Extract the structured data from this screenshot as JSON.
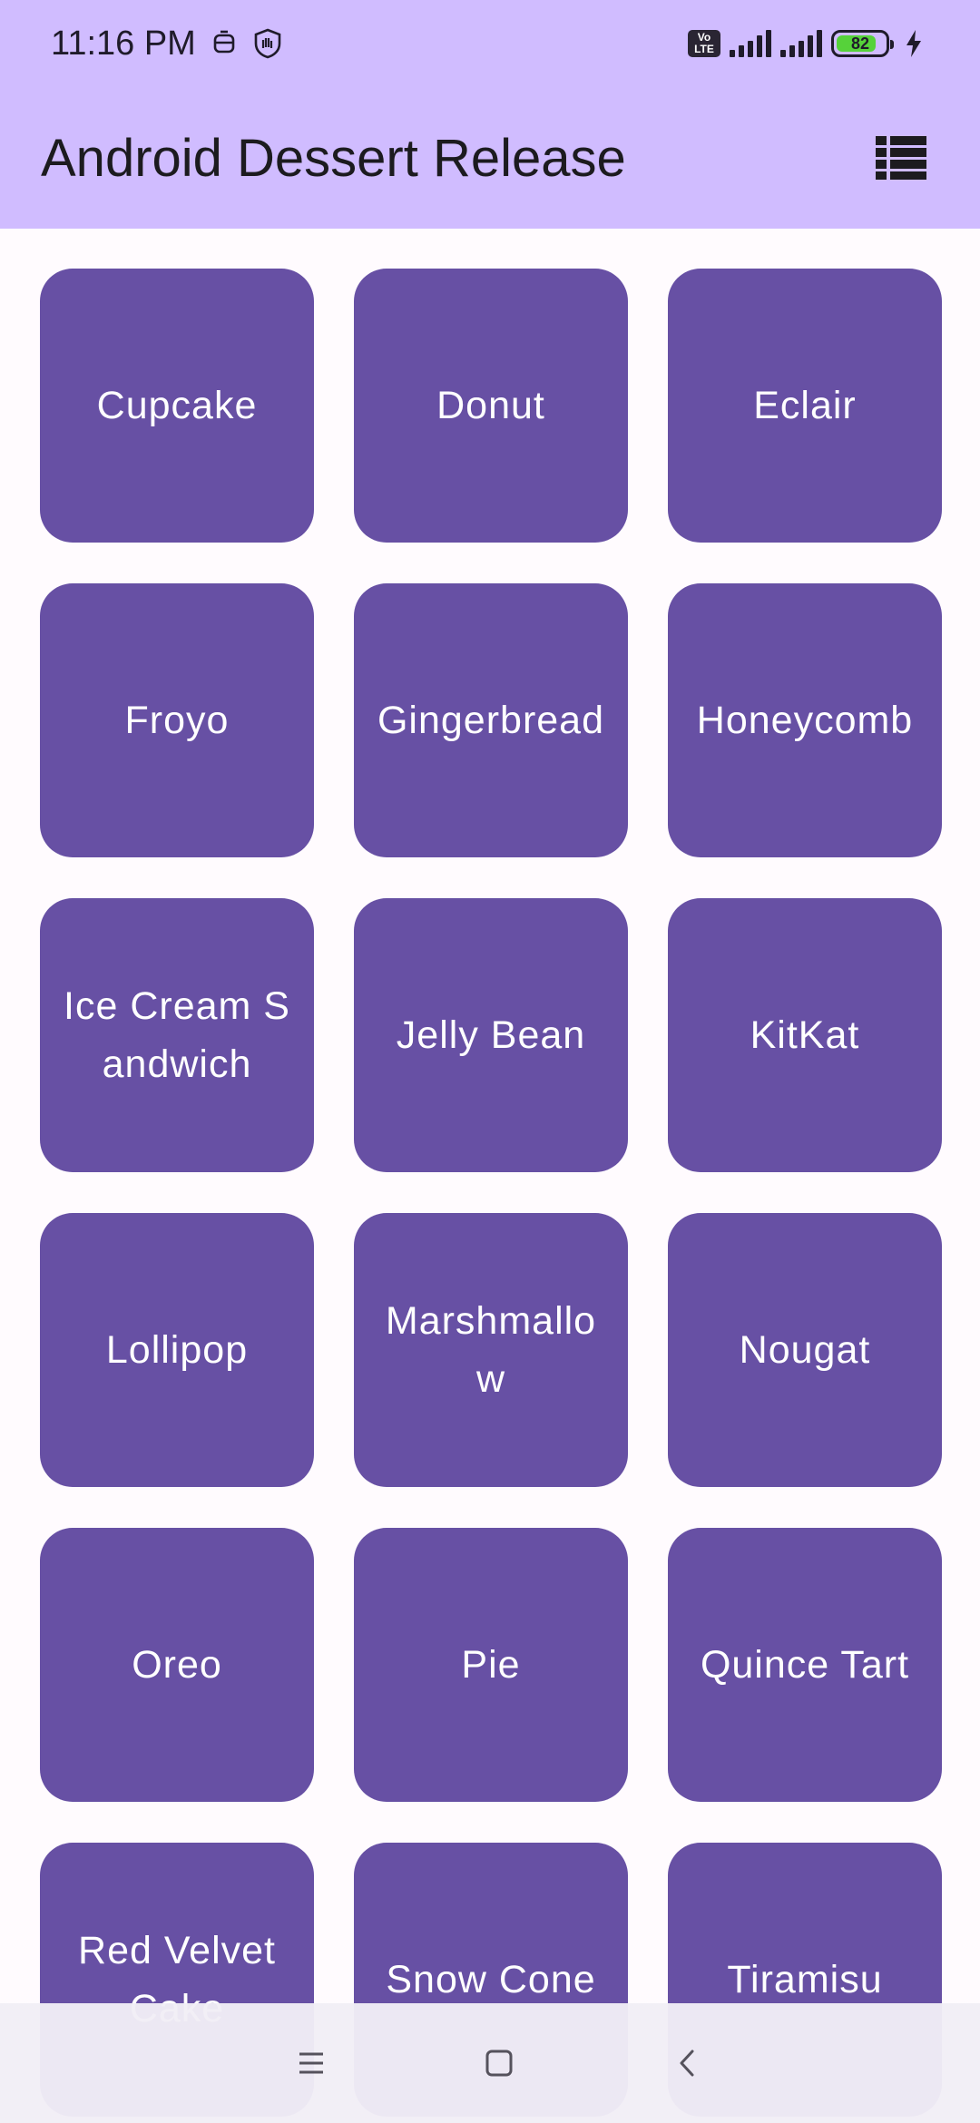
{
  "status_bar": {
    "time": "11:16 PM",
    "volte_label": "Vo\nLTE",
    "battery_level": "82",
    "battery_fraction": 0.82,
    "icons": [
      "notification-icon",
      "shield-hand-icon",
      "volte-icon",
      "signal-icon",
      "signal-icon",
      "battery-icon",
      "charging-icon"
    ]
  },
  "app_bar": {
    "title": "Android Dessert Release",
    "action_icon": "list-layout-icon"
  },
  "desserts": [
    "Cupcake",
    "Donut",
    "Eclair",
    "Froyo",
    "Gingerbread",
    "Honeycomb",
    "Ice Cream Sandwich",
    "Jelly Bean",
    "KitKat",
    "Lollipop",
    "Marshmallow",
    "Nougat",
    "Oreo",
    "Pie",
    "Quince Tart",
    "Red Velvet Cake",
    "Snow Cone",
    "Tiramisu"
  ],
  "nav_bar": {
    "icons": [
      "menu-icon",
      "home-icon",
      "back-icon"
    ]
  },
  "colors": {
    "app_bar": "#d0bcff",
    "tile": "#6750a4",
    "background": "#fffbfe",
    "tile_text": "#ffffff"
  }
}
